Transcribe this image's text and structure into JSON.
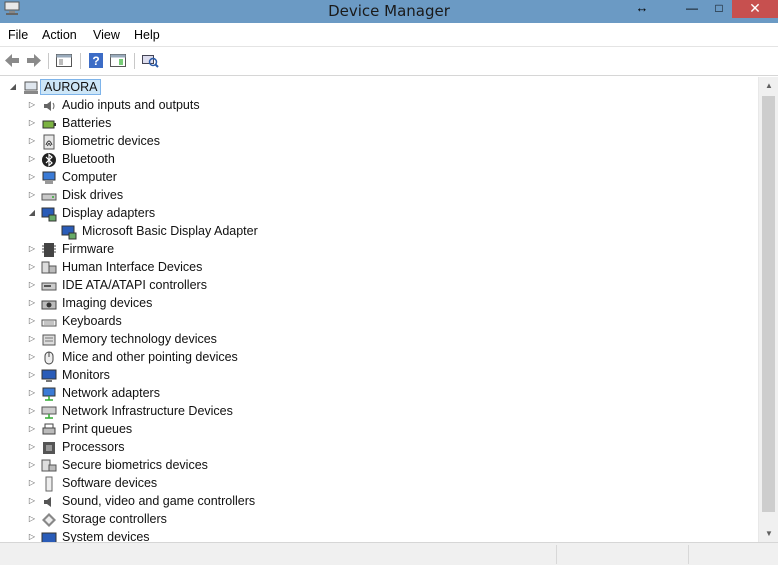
{
  "window": {
    "title": "Device Manager",
    "restore_glyph": "↔",
    "min_glyph": "—",
    "max_glyph": "□",
    "close_glyph": "✕"
  },
  "menu": [
    "File",
    "Action",
    "View",
    "Help"
  ],
  "toolbar": {
    "tools": [
      "back-icon",
      "forward-icon",
      "properties-panel-icon",
      "help-icon",
      "console-tree-icon",
      "scan-hardware-icon"
    ]
  },
  "tree": {
    "root": "AURORA",
    "expanded_glyph": "◢",
    "collapsed_glyph": "▷",
    "items": [
      {
        "label": "Audio inputs and outputs",
        "icon": "speaker-icon"
      },
      {
        "label": "Batteries",
        "icon": "battery-icon"
      },
      {
        "label": "Biometric devices",
        "icon": "fingerprint-icon"
      },
      {
        "label": "Bluetooth",
        "icon": "bluetooth-icon"
      },
      {
        "label": "Computer",
        "icon": "computer-icon"
      },
      {
        "label": "Disk drives",
        "icon": "disk-drive-icon"
      },
      {
        "label": "Display adapters",
        "icon": "display-adapter-icon",
        "expanded": true
      },
      {
        "label": "Microsoft Basic Display Adapter",
        "icon": "display-adapter-icon",
        "child": true
      },
      {
        "label": "Firmware",
        "icon": "firmware-icon"
      },
      {
        "label": "Human Interface Devices",
        "icon": "hid-icon"
      },
      {
        "label": "IDE ATA/ATAPI controllers",
        "icon": "ide-controller-icon"
      },
      {
        "label": "Imaging devices",
        "icon": "camera-icon"
      },
      {
        "label": "Keyboards",
        "icon": "keyboard-icon"
      },
      {
        "label": "Memory technology devices",
        "icon": "memory-icon"
      },
      {
        "label": "Mice and other pointing devices",
        "icon": "mouse-icon"
      },
      {
        "label": "Monitors",
        "icon": "monitor-icon"
      },
      {
        "label": "Network adapters",
        "icon": "network-adapter-icon"
      },
      {
        "label": "Network Infrastructure Devices",
        "icon": "network-infrastructure-icon"
      },
      {
        "label": "Print queues",
        "icon": "printer-icon"
      },
      {
        "label": "Processors",
        "icon": "processor-icon"
      },
      {
        "label": "Secure biometrics devices",
        "icon": "secure-biometrics-icon"
      },
      {
        "label": "Software devices",
        "icon": "software-device-icon"
      },
      {
        "label": "Sound, video and game controllers",
        "icon": "sound-icon"
      },
      {
        "label": "Storage controllers",
        "icon": "storage-controller-icon"
      },
      {
        "label": "System devices",
        "icon": "system-devices-icon"
      }
    ]
  },
  "scrollbar": {
    "up_glyph": "▲",
    "down_glyph": "▼"
  },
  "colors": {
    "titlebar": "#6b9ac4",
    "close": "#c7504f",
    "selection": "#cde6f7"
  }
}
